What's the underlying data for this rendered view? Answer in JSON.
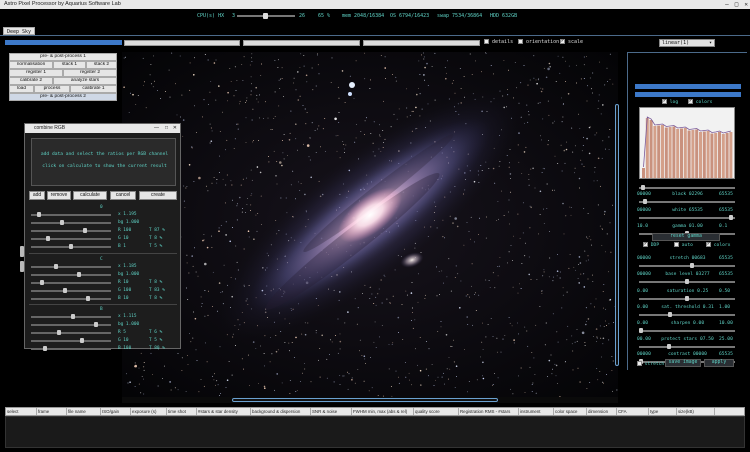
{
  "window": {
    "title": "Astro Pixel Processor by  Aquarius Software Lab",
    "controls": [
      "—",
      "□",
      "✕"
    ]
  },
  "status": {
    "cpu_label": "CPU(s) HX",
    "cpu_min": "3",
    "cpu_value": "26",
    "cpu_pct": "65 %",
    "mem": "mem 2048/16384",
    "os": "OS 6794/16423",
    "swap": "swap 7534/36864",
    "hdd": "HDD 632GB"
  },
  "tabs": [
    {
      "label": "Deep Sky"
    }
  ],
  "topbar": {
    "details_label": "details",
    "orientation_label": "orientation",
    "scale_label": "scale",
    "stretch_mode": "linear(1)"
  },
  "process_buttons": {
    "row1": [
      "pre- & post-process 1"
    ],
    "row2": [
      "normalisation",
      "stack 1",
      "stack 2"
    ],
    "row3": [
      "register 1",
      "register 2"
    ],
    "row4": [
      "calibrate 2",
      "analyze stars"
    ],
    "row5": [
      "load",
      "process",
      "calibrate 1"
    ],
    "row6": [
      "pre- & post-process 2"
    ]
  },
  "dialog": {
    "title": "combine RGB",
    "message_line1": "add data and select the ratios per RGB channel",
    "message_line2": "click on calculate to show the current result",
    "buttons": [
      "add",
      "remove",
      "calculate",
      "cancel",
      "create"
    ],
    "groups": [
      {
        "name": "0",
        "rows": [
          "x 1.195",
          "bg 1.000",
          "R 100",
          "G 10",
          "B 1"
        ],
        "pcts": [
          "",
          "",
          "T 87 %",
          "T 8 %",
          "T 5 %"
        ]
      },
      {
        "name": "C",
        "rows": [
          "x 1.185",
          "bg 1.000",
          "R 10",
          "G 100",
          "B 10"
        ],
        "pcts": [
          "",
          "",
          "T 8 %",
          "T 83 %",
          "T 8 %"
        ]
      },
      {
        "name": "B",
        "rows": [
          "x 1.115",
          "bg 1.000",
          "R 5",
          "G 10",
          "B 100"
        ],
        "pcts": [
          "",
          "",
          "T 6 %",
          "T 5 %",
          "T 80 %"
        ]
      }
    ]
  },
  "right_panel": {
    "log_label": "log",
    "colors_label": "colors",
    "black": {
      "min": "00000",
      "label": "black 02296",
      "max": "65535"
    },
    "white": {
      "min": "00000",
      "label": "white 65535",
      "max": "65535"
    },
    "gamma": {
      "min": "10.0",
      "label": "gamma 01.00",
      "max": "0.1"
    },
    "reset_gamma": "reset gamma",
    "ddp_label": "DDP",
    "auto_label": "auto",
    "colorx_label": "colorx",
    "stretch": {
      "min": "00000",
      "label": "stretch 00683",
      "max": "65535"
    },
    "base_level": {
      "min": "00000",
      "label": "base level 03277",
      "max": "65535"
    },
    "saturation": {
      "min": "0.00",
      "label": "saturation 0.25",
      "max": "0.50"
    },
    "sat_threshold": {
      "min": "0.00",
      "label": "sat. threshold 0.31",
      "max": "1.00"
    },
    "sharpen": {
      "min": "0.00",
      "label": "sharpen 0.00",
      "max": "10.00"
    },
    "protect_stars": {
      "min": "00.00",
      "label": "protect stars 07.50",
      "max": "25.00"
    },
    "contrast": {
      "min": "00000",
      "label": "contrast 00000",
      "max": "65535"
    },
    "stretch_check": "stretch",
    "save_image": "save image",
    "apply": "apply"
  },
  "table_columns": [
    "select",
    "frame",
    "file name",
    "ISO/gain",
    "exposure (s)",
    "time shot",
    "#stars & star density",
    "background & dispersion",
    "SNR & noise",
    "FWHM min, max (abs & rel)",
    "quality score",
    "Registration RMS - #stars",
    "instrument",
    "color space",
    "dimension",
    "CFA",
    "type",
    "size(kB)"
  ],
  "accent_colors": {
    "teal_text": "#5fd3c6",
    "blue_bar": "#3c78c8",
    "panel_border": "#4b6a8a"
  }
}
